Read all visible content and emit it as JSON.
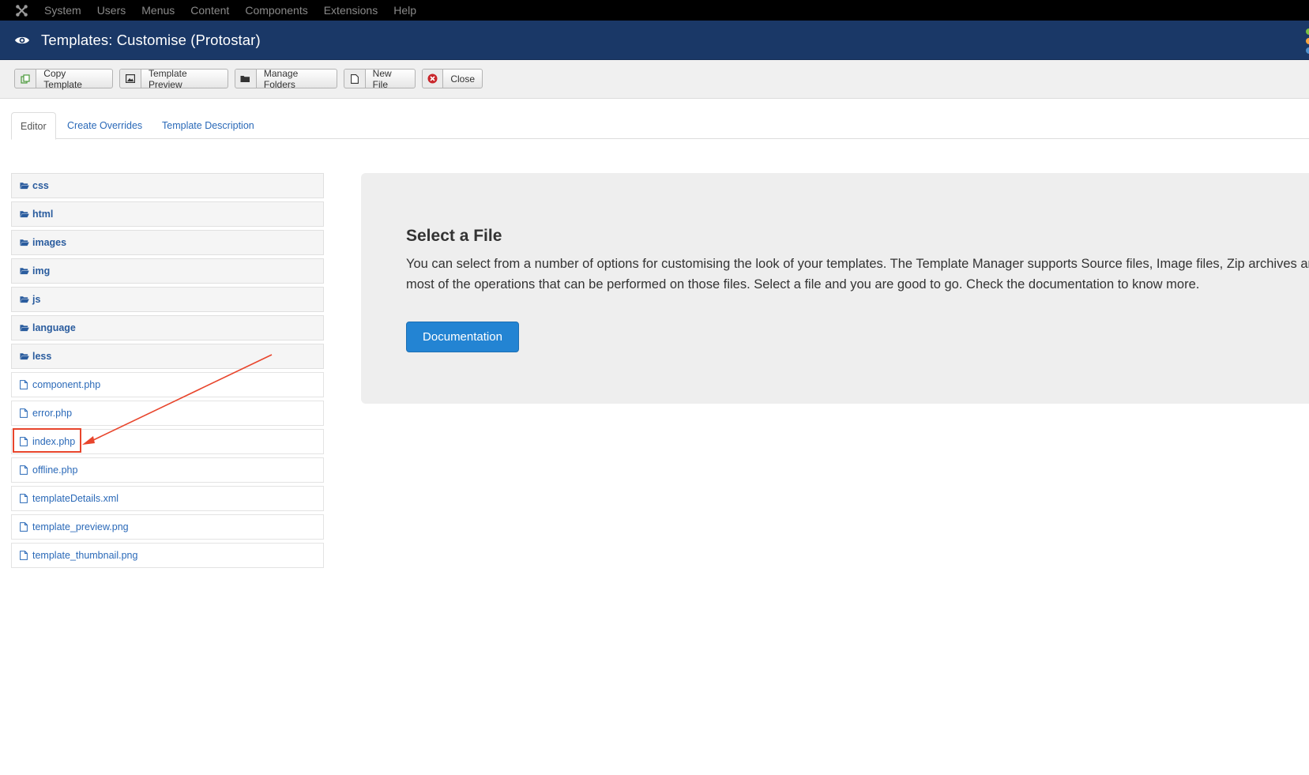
{
  "topbar": {
    "menu": [
      "System",
      "Users",
      "Menus",
      "Content",
      "Components",
      "Extensions",
      "Help"
    ]
  },
  "header": {
    "title": "Templates: Customise (Protostar)"
  },
  "toolbar": {
    "buttons": [
      {
        "label": "Copy Template",
        "icon": "copy-icon"
      },
      {
        "label": "Template Preview",
        "icon": "image-icon"
      },
      {
        "label": "Manage Folders",
        "icon": "folder-icon"
      },
      {
        "label": "New File",
        "icon": "file-icon"
      },
      {
        "label": "Close",
        "icon": "close-circle-icon"
      }
    ]
  },
  "tabs": [
    {
      "label": "Editor",
      "active": true
    },
    {
      "label": "Create Overrides",
      "active": false
    },
    {
      "label": "Template Description",
      "active": false
    }
  ],
  "tree": {
    "folders": [
      "css",
      "html",
      "images",
      "img",
      "js",
      "language",
      "less"
    ],
    "files": [
      "component.php",
      "error.php",
      "index.php",
      "offline.php",
      "templateDetails.xml",
      "template_preview.png",
      "template_thumbnail.png"
    ]
  },
  "panel": {
    "heading": "Select a File",
    "description": "You can select from a number of options for customising the look of your templates. The Template Manager supports Source files, Image files, Zip archives and most of the operations that can be performed on those files. Select a file and you are good to go. Check the documentation to know more.",
    "button_label": "Documentation"
  },
  "colors": {
    "topbar": "#000000",
    "header": "#1a3867",
    "link": "#2a69b8",
    "primary_button": "#2384d3",
    "annotation": "#e8452c"
  }
}
